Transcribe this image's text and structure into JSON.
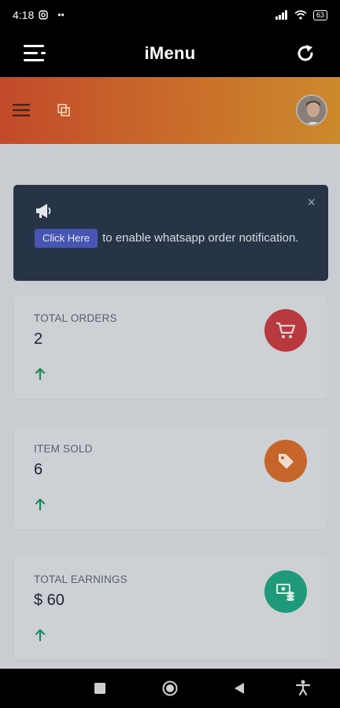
{
  "status_bar": {
    "time": "4:18",
    "dots": "••",
    "battery": "63"
  },
  "app_bar": {
    "title": "iMenu"
  },
  "notice": {
    "button_label": "Click Here",
    "message": " to enable whatsapp order notification.",
    "close_glyph": "×"
  },
  "cards": [
    {
      "label": "TOTAL ORDERS",
      "value": "2",
      "icon": "cart-icon",
      "color": "#b83a3f"
    },
    {
      "label": "ITEM SOLD",
      "value": "6",
      "icon": "tag-icon",
      "color": "#c6652a"
    },
    {
      "label": "TOTAL EARNINGS",
      "value": "$ 60",
      "icon": "money-icon",
      "color": "#1f9a78"
    }
  ],
  "colors": {
    "trend_up": "#1d8a5a",
    "notice_bg": "#273447",
    "header_gradient_start": "#c24a2a",
    "header_gradient_end": "#cc8a2c"
  }
}
